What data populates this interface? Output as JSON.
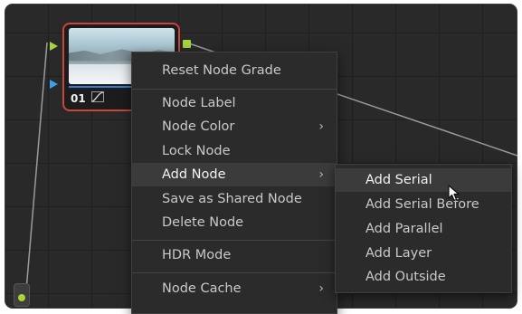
{
  "node": {
    "number": "01",
    "curve_icon": "curves-icon"
  },
  "context_menu": {
    "items": [
      {
        "label": "Reset Node Grade"
      },
      {
        "label": "Node Label"
      },
      {
        "label": "Node Color",
        "chevron": "›"
      },
      {
        "label": "Lock Node"
      },
      {
        "label": "Add Node",
        "chevron": "›",
        "highlighted": true
      },
      {
        "label": "Save as Shared Node"
      },
      {
        "label": "Delete Node"
      },
      {
        "label": "HDR Mode"
      },
      {
        "label": "Node Cache",
        "chevron": "›"
      }
    ]
  },
  "submenu": {
    "items": [
      {
        "label": "Add Serial",
        "highlighted": true
      },
      {
        "label": "Add Serial Before"
      },
      {
        "label": "Add Parallel"
      },
      {
        "label": "Add Layer"
      },
      {
        "label": "Add Outside"
      }
    ]
  },
  "colors": {
    "node_border": "#c8463b",
    "rgb_port": "#a6d43a",
    "key_port": "#3aa2e4",
    "menu_bg": "#2b2b2c",
    "menu_highlight": "#3b3b3c"
  }
}
